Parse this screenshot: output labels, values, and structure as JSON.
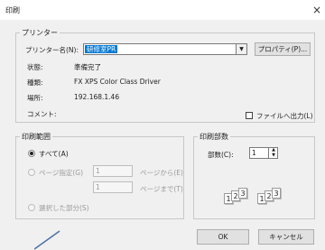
{
  "window": {
    "title": "印刷",
    "close_glyph": "×"
  },
  "printer_group": {
    "legend": "プリンター",
    "name_label": "プリンター名(N):",
    "selected_printer": "研修室PR",
    "properties_button": "プロパティ(P)...",
    "status_label": "状態:",
    "status_value": "準備完了",
    "type_label": "種類:",
    "type_value": "FX XPS Color Class Driver",
    "location_label": "場所:",
    "location_value": "192.168.1.46",
    "comment_label": "コメント:",
    "print_to_file_label": "ファイルへ出力(L)"
  },
  "range_group": {
    "legend": "印刷範囲",
    "all_label": "すべて(A)",
    "pages_label": "ページ指定(G)",
    "from_value": "1",
    "from_suffix": "ページから(E)",
    "to_value": "1",
    "to_suffix": "ページまで(T)",
    "selection_label": "選択した部分(S)"
  },
  "copies_group": {
    "legend": "印刷部数",
    "copies_label": "部数(C):",
    "copies_value": "1",
    "collate_page_labels": [
      "1",
      "2",
      "3"
    ]
  },
  "buttons": {
    "ok": "OK",
    "cancel": "キャンセル"
  },
  "colors": {
    "selection_blue": "#0078d7",
    "dialog_bg": "#f0f0f0"
  }
}
